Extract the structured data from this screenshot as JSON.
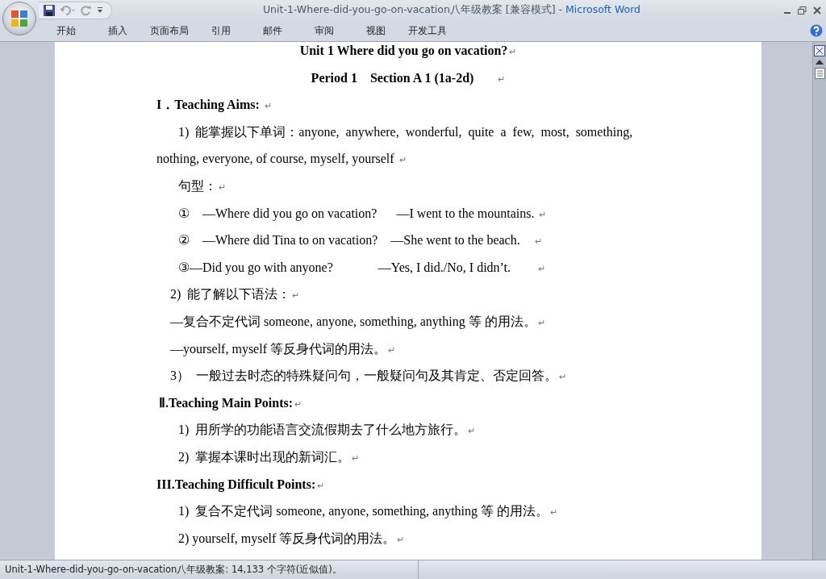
{
  "window": {
    "document_title": "Unit-1-Where-did-you-go-on-vacation八年级教案 [兼容模式]",
    "separator": " - ",
    "app_name": "Microsoft Word"
  },
  "ribbon_tabs": [
    {
      "label": "开始",
      "selected": false
    },
    {
      "label": "插入",
      "selected": false
    },
    {
      "label": "页面布局",
      "selected": false
    },
    {
      "label": "引用",
      "selected": false
    },
    {
      "label": "邮件",
      "selected": false
    },
    {
      "label": "审阅",
      "selected": false
    },
    {
      "label": "视图",
      "selected": false
    },
    {
      "label": "开发工具",
      "selected": false
    }
  ],
  "paragraphs": [
    {
      "kind": "title",
      "text": "Unit 1 Where did you go on vacation?",
      "mark": "↵"
    },
    {
      "kind": "title",
      "text": "Period 1    Section A 1 (1a-2d)       ",
      "mark": "↵"
    },
    {
      "kind": "heading",
      "text": "I．Teaching Aims: ",
      "mark": "↵"
    },
    {
      "kind": "item",
      "text": "1)  能掌握以下单词：anyone,  anywhere,  wonderful,  quite  a  few,  most,  something,"
    },
    {
      "kind": "plain",
      "text": "nothing, everyone, of course, myself, yourself ",
      "mark": "↵"
    },
    {
      "kind": "item",
      "text": "句型：",
      "mark": "↵"
    },
    {
      "kind": "item",
      "text": "①    —Where did you go on vacation?      —I went to the mountains. ",
      "mark": "↵"
    },
    {
      "kind": "item",
      "text": "②    —Where did Tina to on vacation?    —She went to the beach.    ",
      "mark": "↵"
    },
    {
      "kind": "item",
      "text": "③—Did you go with anyone?              —Yes, I did./No, I didn’t.        ",
      "mark": "↵"
    },
    {
      "kind": "sub",
      "text": "2)  能了解以下语法：",
      "mark": "↵"
    },
    {
      "kind": "sub",
      "text": "—复合不定代词 someone, anyone, something, anything 等 的用法。",
      "mark": "↵"
    },
    {
      "kind": "sub",
      "text": "—yourself, myself 等反身代词的用法。",
      "mark": "↵"
    },
    {
      "kind": "sub",
      "text": "3）  一般过去时态的特殊疑问句，一般疑问句及其肯定、否定回答。",
      "mark": "↵"
    },
    {
      "kind": "heading2",
      "text": "Ⅱ.Teaching Main Points:",
      "mark": "↵"
    },
    {
      "kind": "item",
      "text": "1)  用所学的功能语言交流假期去了什么地方旅行。",
      "mark": "↵"
    },
    {
      "kind": "item",
      "text": "2)  掌握本课时出现的新词汇。",
      "mark": "↵"
    },
    {
      "kind": "heading",
      "text": "III.Teaching Difficult Points:",
      "mark": "↵"
    },
    {
      "kind": "item",
      "text": "1)  复合不定代词 someone, anyone, something, anything 等 的用法。",
      "mark": "↵"
    },
    {
      "kind": "item",
      "text": "2) yourself, myself 等反身代词的用法。",
      "mark": "↵"
    }
  ],
  "status_bar": {
    "text": "Unit-1-Where-did-you-go-on-vacation八年级教案: 14,133 个字符(近似值)。"
  }
}
